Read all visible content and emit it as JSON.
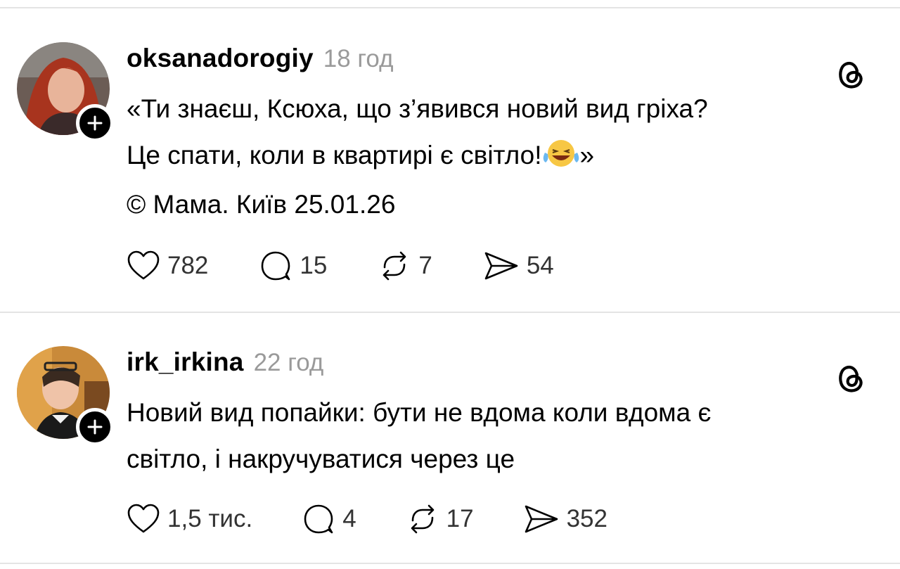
{
  "posts": [
    {
      "username": "oksanadorogiy",
      "time": "18 год",
      "lines": [
        "«Ти знаєш, Ксюха, що з’явився новий вид гріха?",
        "Це спати, коли в квартирі є світло!",
        "»",
        "© Мама. Київ 25.01.26"
      ],
      "stats": {
        "likes": "782",
        "replies": "15",
        "reposts": "7",
        "shares": "54"
      }
    },
    {
      "username": "irk_irkina",
      "time": "22 год",
      "lines": [
        "Новий вид попайки: бути не вдома коли вдома є",
        "світло, і накручуватися через це"
      ],
      "stats": {
        "likes": "1,5 тис.",
        "replies": "4",
        "reposts": "17",
        "shares": "352"
      }
    }
  ],
  "icons": [
    "heart-icon",
    "reply-icon",
    "repost-icon",
    "share-icon",
    "threads-logo-icon",
    "plus-icon",
    "laughing-emoji"
  ],
  "colors": {
    "text": "#000000",
    "muted": "#9a9a9a",
    "divider": "#e4e4e4"
  }
}
